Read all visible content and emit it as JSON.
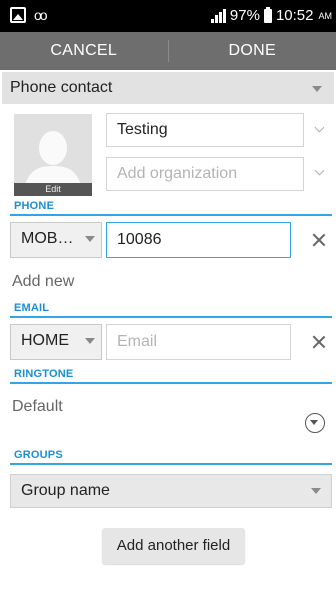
{
  "status_bar": {
    "battery": "97%",
    "time": "10:52",
    "ampm": "AM"
  },
  "action_bar": {
    "cancel_label": "CANCEL",
    "done_label": "DONE"
  },
  "account": {
    "selected": "Phone contact"
  },
  "photo": {
    "edit_label": "Edit"
  },
  "name": {
    "value": "Testing"
  },
  "organization": {
    "placeholder": "Add organization"
  },
  "phone": {
    "section_label": "PHONE",
    "type": "MOB…",
    "value": "10086",
    "add_new_label": "Add new"
  },
  "email": {
    "section_label": "EMAIL",
    "type": "HOME",
    "placeholder": "Email"
  },
  "ringtone": {
    "section_label": "RINGTONE",
    "value": "Default"
  },
  "groups": {
    "section_label": "GROUPS",
    "selected": "Group name"
  },
  "add_field_label": "Add another field"
}
